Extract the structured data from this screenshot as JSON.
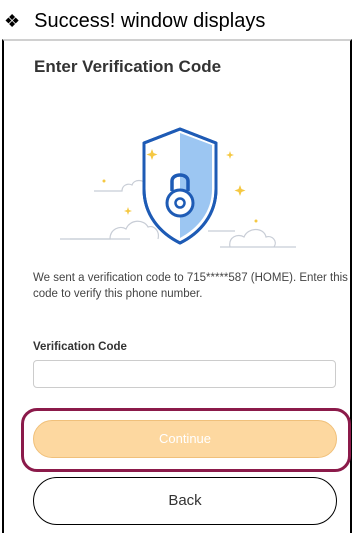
{
  "doc": {
    "bullet": "❖",
    "heading": "Success! window displays"
  },
  "dialog": {
    "title": "Enter Verification Code",
    "illustration_icon": "padlock-shield-icon",
    "message": "We sent a verification code to 715*****587 (HOME). Enter this code to verify this phone number.",
    "field_label": "Verification Code",
    "field_value": "",
    "continue_label": "Continue",
    "back_label": "Back"
  },
  "colors": {
    "continue_bg": "#fdd8a0",
    "highlight_ring": "#8b1a4a",
    "shield_blue": "#1e5bb5",
    "shield_fill": "#9cc6f2",
    "sparkle": "#f5c842"
  }
}
